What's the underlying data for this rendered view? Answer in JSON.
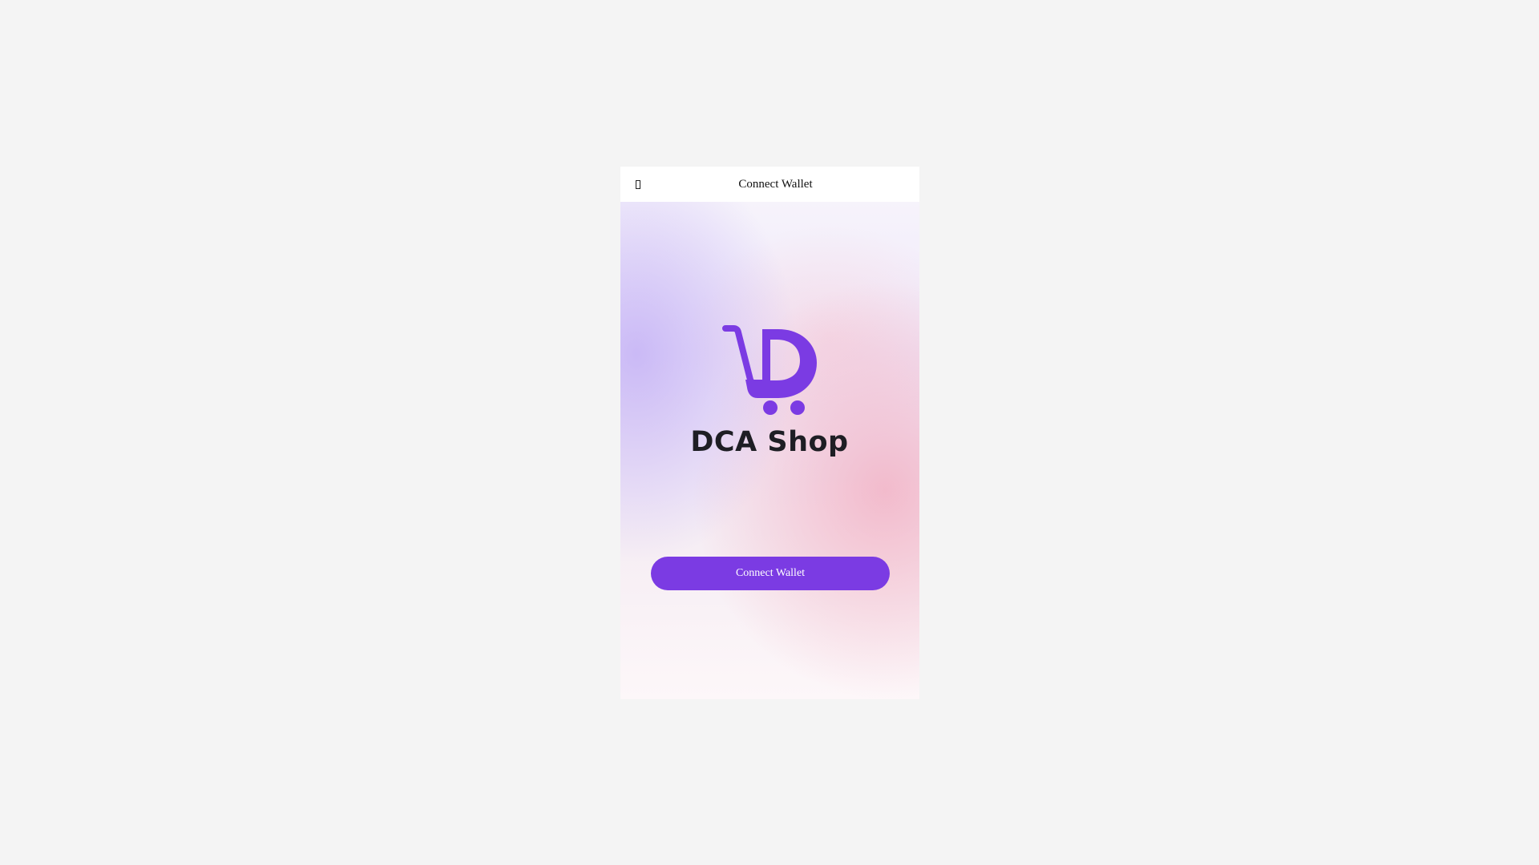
{
  "header": {
    "back_icon": "back-icon",
    "title": "Connect Wallet"
  },
  "logo": {
    "icon": "shopping-cart-d-icon",
    "brand_text": "DCA Shop",
    "color": "#7b3be3"
  },
  "actions": {
    "connect_label": "Connect Wallet",
    "button_color": "#7b3be3"
  },
  "colors": {
    "page_background": "#f4f4f4",
    "gradient_purple": "#bfa9f5",
    "gradient_pink": "#f2aabe"
  }
}
